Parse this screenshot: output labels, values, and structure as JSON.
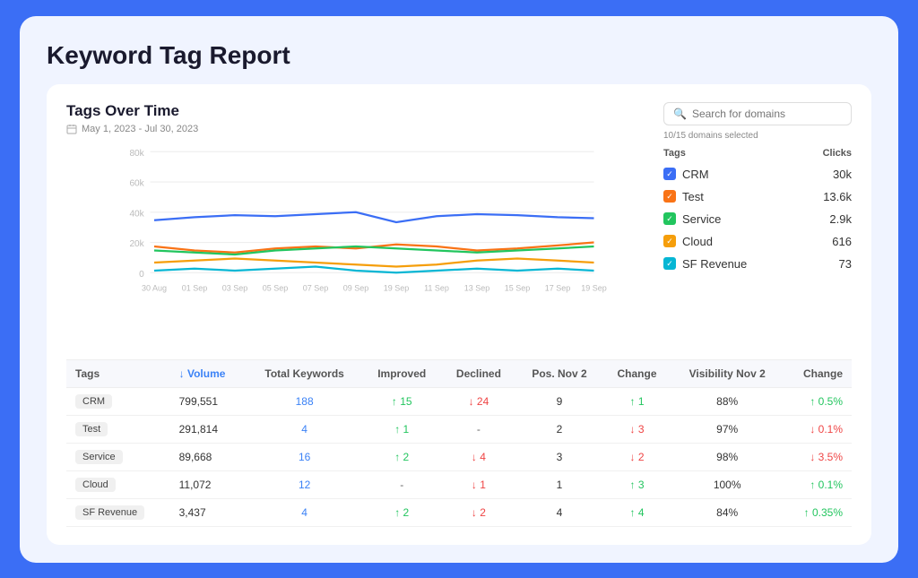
{
  "page": {
    "title": "Keyword Tag Report"
  },
  "chart": {
    "title": "Tags Over Time",
    "subtitle": "May 1, 2023 - Jul 30, 2023",
    "y_labels": [
      "80k",
      "60k",
      "40k",
      "20k",
      "0"
    ],
    "x_labels": [
      "30 Aug",
      "01 Sep",
      "03 Sep",
      "05 Sep",
      "07 Sep",
      "09 Sep",
      "19 Sep",
      "11 Sep",
      "13 Sep",
      "15 Sep",
      "17 Sep",
      "19 Sep"
    ]
  },
  "search": {
    "placeholder": "Search for domains"
  },
  "domains_selected": "10/15 domains selected",
  "legend": {
    "tags_label": "Tags",
    "clicks_label": "Clicks",
    "items": [
      {
        "id": "crm",
        "color": "#3b6ef5",
        "label": "CRM",
        "clicks": "30k",
        "checked": true
      },
      {
        "id": "test",
        "color": "#f97316",
        "label": "Test",
        "clicks": "13.6k",
        "checked": true
      },
      {
        "id": "service",
        "color": "#22c55e",
        "label": "Service",
        "clicks": "2.9k",
        "checked": true
      },
      {
        "id": "cloud",
        "color": "#f59e0b",
        "label": "Cloud",
        "clicks": "616",
        "checked": true
      },
      {
        "id": "sf-revenue",
        "color": "#06b6d4",
        "label": "SF Revenue",
        "clicks": "73",
        "checked": true
      }
    ]
  },
  "table": {
    "columns": [
      {
        "key": "tags",
        "label": "Tags",
        "align": "left"
      },
      {
        "key": "volume",
        "label": "Volume",
        "align": "left",
        "sort": "↓"
      },
      {
        "key": "total_keywords",
        "label": "Total Keywords",
        "align": "center"
      },
      {
        "key": "improved",
        "label": "Improved",
        "align": "center"
      },
      {
        "key": "declined",
        "label": "Declined",
        "align": "center"
      },
      {
        "key": "pos_nov2",
        "label": "Pos. Nov 2",
        "align": "center"
      },
      {
        "key": "change",
        "label": "Change",
        "align": "center"
      },
      {
        "key": "visibility_nov2",
        "label": "Visibility Nov 2",
        "align": "center"
      },
      {
        "key": "change2",
        "label": "Change",
        "align": "right"
      }
    ],
    "rows": [
      {
        "tag": "CRM",
        "volume": "799,551",
        "total_keywords": "188",
        "total_color": "blue",
        "improved": "↑ 15",
        "improved_color": "green",
        "declined": "↓ 24",
        "declined_color": "red",
        "pos_nov2": "9",
        "change": "↑ 1",
        "change_color": "green",
        "visibility": "88%",
        "change2": "↑ 0.5%",
        "change2_color": "green"
      },
      {
        "tag": "Test",
        "volume": "291,814",
        "total_keywords": "4",
        "total_color": "blue",
        "improved": "↑ 1",
        "improved_color": "green",
        "declined": "-",
        "declined_color": "",
        "pos_nov2": "2",
        "change": "↓ 3",
        "change_color": "red",
        "visibility": "97%",
        "change2": "↓ 0.1%",
        "change2_color": "red"
      },
      {
        "tag": "Service",
        "volume": "89,668",
        "total_keywords": "16",
        "total_color": "blue",
        "improved": "↑ 2",
        "improved_color": "green",
        "declined": "↓ 4",
        "declined_color": "red",
        "pos_nov2": "3",
        "change": "↓ 2",
        "change_color": "red",
        "visibility": "98%",
        "change2": "↓ 3.5%",
        "change2_color": "red"
      },
      {
        "tag": "Cloud",
        "volume": "11,072",
        "total_keywords": "12",
        "total_color": "blue",
        "improved": "-",
        "improved_color": "",
        "declined": "↓ 1",
        "declined_color": "red",
        "pos_nov2": "1",
        "change": "↑ 3",
        "change_color": "green",
        "visibility": "100%",
        "change2": "↑ 0.1%",
        "change2_color": "green"
      },
      {
        "tag": "SF Revenue",
        "volume": "3,437",
        "total_keywords": "4",
        "total_color": "blue",
        "improved": "↑ 2",
        "improved_color": "green",
        "declined": "↓ 2",
        "declined_color": "red",
        "pos_nov2": "4",
        "change": "↑ 4",
        "change_color": "green",
        "visibility": "84%",
        "change2": "↑ 0.35%",
        "change2_color": "green"
      }
    ]
  }
}
